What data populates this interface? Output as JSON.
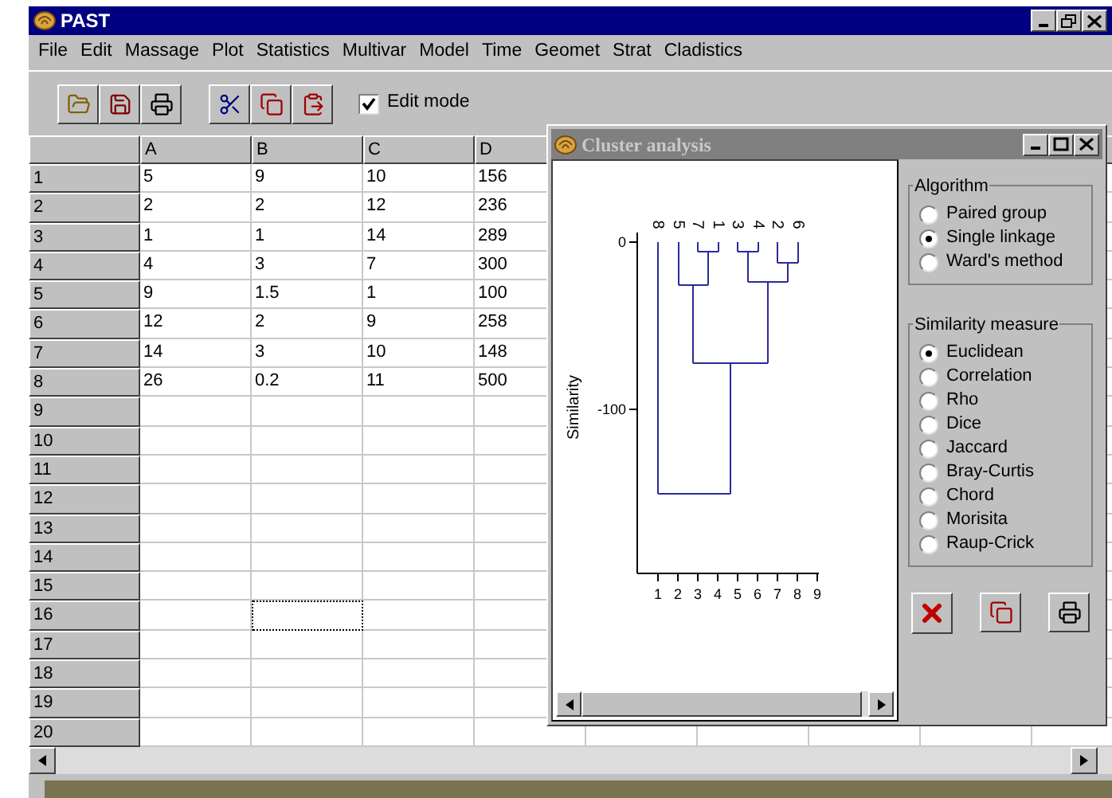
{
  "app": {
    "title": "PAST"
  },
  "menu": [
    "File",
    "Edit",
    "Massage",
    "Plot",
    "Statistics",
    "Multivar",
    "Model",
    "Time",
    "Geomet",
    "Strat",
    "Cladistics"
  ],
  "toolbar": {
    "edit_mode": {
      "label": "Edit mode",
      "checked": true
    }
  },
  "sheet": {
    "columns": [
      "A",
      "B",
      "C",
      "D"
    ],
    "rows": [
      {
        "header": "1",
        "cells": [
          {
            "value": "5",
            "selected": false
          },
          {
            "value": "9",
            "selected": false
          },
          {
            "value": "10",
            "selected": false
          },
          {
            "value": "156",
            "selected": false
          }
        ]
      },
      {
        "header": "2",
        "cells": [
          {
            "value": "2",
            "selected": false
          },
          {
            "value": "2",
            "selected": false
          },
          {
            "value": "12",
            "selected": false
          },
          {
            "value": "236",
            "selected": false
          }
        ]
      },
      {
        "header": "3",
        "cells": [
          {
            "value": "1",
            "selected": false
          },
          {
            "value": "1",
            "selected": false
          },
          {
            "value": "14",
            "selected": false
          },
          {
            "value": "289",
            "selected": false
          }
        ]
      },
      {
        "header": "4",
        "cells": [
          {
            "value": "4",
            "selected": false
          },
          {
            "value": "3",
            "selected": false
          },
          {
            "value": "7",
            "selected": false
          },
          {
            "value": "300",
            "selected": false
          }
        ]
      },
      {
        "header": "5",
        "cells": [
          {
            "value": "9",
            "selected": false
          },
          {
            "value": "1.5",
            "selected": false
          },
          {
            "value": "1",
            "selected": false
          },
          {
            "value": "100",
            "selected": false
          }
        ]
      },
      {
        "header": "6",
        "cells": [
          {
            "value": "12",
            "selected": false
          },
          {
            "value": "2",
            "selected": false
          },
          {
            "value": "9",
            "selected": false
          },
          {
            "value": "258",
            "selected": false
          }
        ]
      },
      {
        "header": "7",
        "cells": [
          {
            "value": "14",
            "selected": false
          },
          {
            "value": "3",
            "selected": false
          },
          {
            "value": "10",
            "selected": false
          },
          {
            "value": "148",
            "selected": false
          }
        ]
      },
      {
        "header": "8",
        "cells": [
          {
            "value": "26",
            "selected": false
          },
          {
            "value": "0.2",
            "selected": false
          },
          {
            "value": "11",
            "selected": false
          },
          {
            "value": "500",
            "selected": false
          }
        ]
      },
      {
        "header": "9",
        "cells": [
          {
            "selected": false
          },
          {
            "selected": false
          },
          {
            "selected": false
          },
          {
            "selected": false
          }
        ]
      },
      {
        "header": "10",
        "cells": [
          {
            "selected": false
          },
          {
            "selected": false
          },
          {
            "selected": false
          },
          {
            "selected": false
          }
        ]
      },
      {
        "header": "11",
        "cells": [
          {
            "selected": false
          },
          {
            "selected": false
          },
          {
            "selected": false
          },
          {
            "selected": false
          }
        ]
      },
      {
        "header": "12",
        "cells": [
          {
            "selected": false
          },
          {
            "selected": false
          },
          {
            "selected": false
          },
          {
            "selected": false
          }
        ]
      },
      {
        "header": "13",
        "cells": [
          {
            "selected": false
          },
          {
            "selected": false
          },
          {
            "selected": false
          },
          {
            "selected": false
          }
        ]
      },
      {
        "header": "14",
        "cells": [
          {
            "selected": false
          },
          {
            "selected": false
          },
          {
            "selected": false
          },
          {
            "selected": false
          }
        ]
      },
      {
        "header": "15",
        "cells": [
          {
            "selected": false
          },
          {
            "selected": false
          },
          {
            "selected": false
          },
          {
            "selected": false
          }
        ]
      },
      {
        "header": "16",
        "cells": [
          {
            "selected": false
          },
          {
            "selected": true
          },
          {
            "selected": false
          },
          {
            "selected": false
          }
        ]
      },
      {
        "header": "17",
        "cells": [
          {
            "selected": false
          },
          {
            "selected": false
          },
          {
            "selected": false
          },
          {
            "selected": false
          }
        ]
      },
      {
        "header": "18",
        "cells": [
          {
            "selected": false
          },
          {
            "selected": false
          },
          {
            "selected": false
          },
          {
            "selected": false
          }
        ]
      },
      {
        "header": "19",
        "cells": [
          {
            "selected": false
          },
          {
            "selected": false
          },
          {
            "selected": false
          },
          {
            "selected": false
          }
        ]
      },
      {
        "header": "20",
        "cells": [
          {
            "selected": false
          },
          {
            "selected": false
          },
          {
            "selected": false
          },
          {
            "selected": false
          }
        ]
      }
    ]
  },
  "cluster_window": {
    "title": "Cluster analysis",
    "plot": {
      "ylabel": "Similarity",
      "yticks": [
        "0",
        "-100"
      ],
      "xticks": [
        "1",
        "2",
        "3",
        "4",
        "5",
        "6",
        "7",
        "8",
        "9"
      ],
      "leaves": [
        "8",
        "5",
        "7",
        "1",
        "3",
        "4",
        "2",
        "6"
      ]
    },
    "algorithm": {
      "title": "Algorithm",
      "options": [
        {
          "label": "Paired group",
          "selected": false
        },
        {
          "label": "Single linkage",
          "selected": true
        },
        {
          "label": "Ward's method",
          "selected": false
        }
      ]
    },
    "similarity": {
      "title": "Similarity measure",
      "options": [
        {
          "label": "Euclidean",
          "selected": true
        },
        {
          "label": "Correlation",
          "selected": false
        },
        {
          "label": "Rho",
          "selected": false
        },
        {
          "label": "Dice",
          "selected": false
        },
        {
          "label": "Jaccard",
          "selected": false
        },
        {
          "label": "Bray-Curtis",
          "selected": false
        },
        {
          "label": "Chord",
          "selected": false
        },
        {
          "label": "Morisita",
          "selected": false
        },
        {
          "label": "Raup-Crick",
          "selected": false
        }
      ]
    }
  }
}
